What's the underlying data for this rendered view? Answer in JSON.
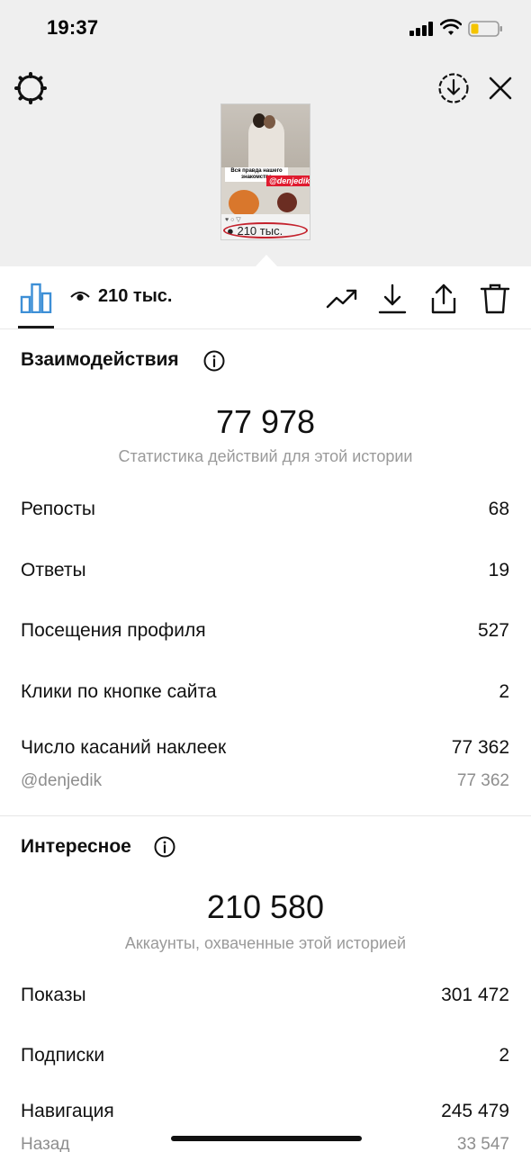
{
  "status_bar": {
    "time": "19:37"
  },
  "preview": {
    "caption": "Вся правда нашего знакомства",
    "small_tag": "",
    "mention": "@denjedik",
    "views": "210 тыс."
  },
  "toolbar": {
    "views": "210 тыс."
  },
  "interactions": {
    "title": "Взаимодействия",
    "total": "77 978",
    "caption": "Статистика действий для этой истории",
    "rows": [
      {
        "label": "Репосты",
        "value": "68"
      },
      {
        "label": "Ответы",
        "value": "19"
      },
      {
        "label": "Посещения профиля",
        "value": "527"
      },
      {
        "label": "Клики по кнопке сайта",
        "value": "2"
      },
      {
        "label": "Число касаний наклеек",
        "value": "77 362"
      }
    ],
    "sub_row": {
      "label": "@denjedik",
      "value": "77 362"
    }
  },
  "discovery": {
    "title": "Интересное",
    "total": "210 580",
    "caption": "Аккаунты, охваченные этой историей",
    "rows": [
      {
        "label": "Показы",
        "value": "301 472"
      },
      {
        "label": "Подписки",
        "value": "2"
      },
      {
        "label": "Навигация",
        "value": "245 479"
      }
    ],
    "sub_row": {
      "label": "Назад",
      "value": "33 547"
    }
  },
  "colors": {
    "mention_red": "#e01b2f",
    "icon_blue": "#3d8fd6",
    "muted": "#8e8e8e"
  }
}
